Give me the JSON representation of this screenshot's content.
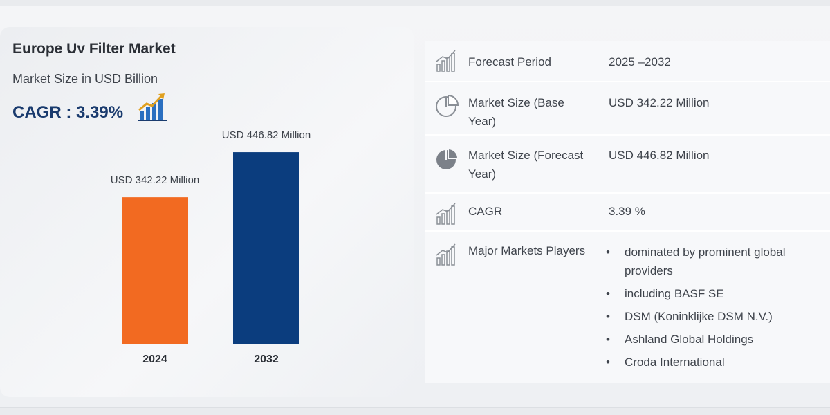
{
  "header": {
    "title": "Europe Uv Filter Market",
    "subtitle": "Market Size in USD Billion",
    "cagr_label": "CAGR : 3.39%"
  },
  "icons": {
    "cagr": "bar-chart-growth-icon",
    "forecast_period": "bar-chart-icon",
    "market_size_base": "pie-chart-outline-icon",
    "market_size_forecast": "pie-chart-filled-icon",
    "cagr_row": "bar-chart-icon",
    "major_players": "bar-chart-icon"
  },
  "colors": {
    "bar_2024": "#f26a21",
    "bar_2032": "#0b3d7e",
    "cagr_text": "#1a3b6e"
  },
  "chart_data": {
    "type": "bar",
    "title": "Europe Uv Filter Market",
    "categories": [
      "2024",
      "2032"
    ],
    "values": [
      342.22,
      446.82
    ],
    "value_labels": [
      "USD 342.22 Million",
      "USD 446.82 Million"
    ],
    "xlabel": "",
    "ylabel": "",
    "ylim": [
      0,
      500
    ],
    "grid": false
  },
  "table": {
    "forecast_period": {
      "label": "Forecast Period",
      "value": "2025 –2032"
    },
    "market_size_base": {
      "label": "Market Size (Base Year)",
      "value": "USD 342.22 Million"
    },
    "market_size_forecast": {
      "label": "Market Size (Forecast Year)",
      "value": "USD 446.82 Million"
    },
    "cagr": {
      "label": "CAGR",
      "value": "3.39 %"
    },
    "major_players": {
      "label": "Major Markets Players",
      "items": [
        "dominated by prominent global providers",
        "including BASF SE",
        "DSM (Koninklijke DSM N.V.)",
        "Ashland Global Holdings",
        "Croda International"
      ]
    }
  }
}
